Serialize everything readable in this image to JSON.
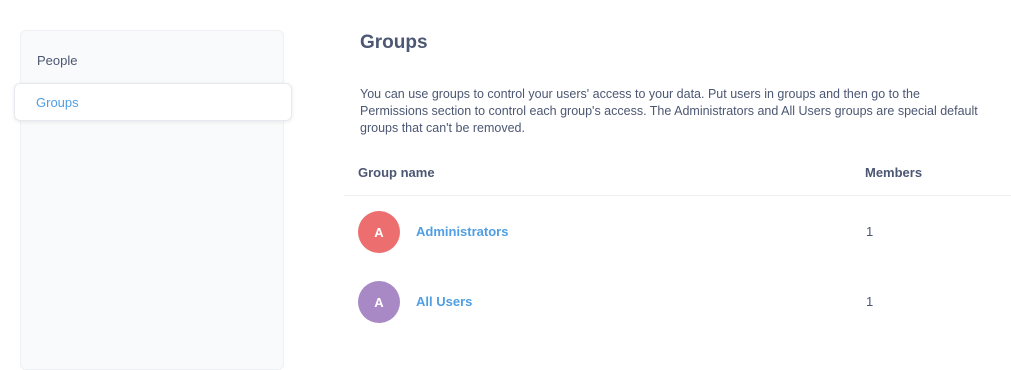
{
  "sidebar": {
    "items": [
      {
        "label": "People"
      },
      {
        "label": "Groups"
      }
    ]
  },
  "main": {
    "title": "Groups",
    "description": "You can use groups to control your users' access to your data. Put users in groups and then go to the Permissions section to control each group's access. The Administrators and All Users groups are special default groups that can't be removed.",
    "table": {
      "columns": [
        "Group name",
        "Members"
      ],
      "rows": [
        {
          "initial": "A",
          "name": "Administrators",
          "members": "1",
          "avatar_color": "#ed6e6e"
        },
        {
          "initial": "A",
          "name": "All Users",
          "members": "1",
          "avatar_color": "#a989c5"
        }
      ]
    }
  },
  "colors": {
    "accent": "#509ee3",
    "text": "#4c5773"
  }
}
